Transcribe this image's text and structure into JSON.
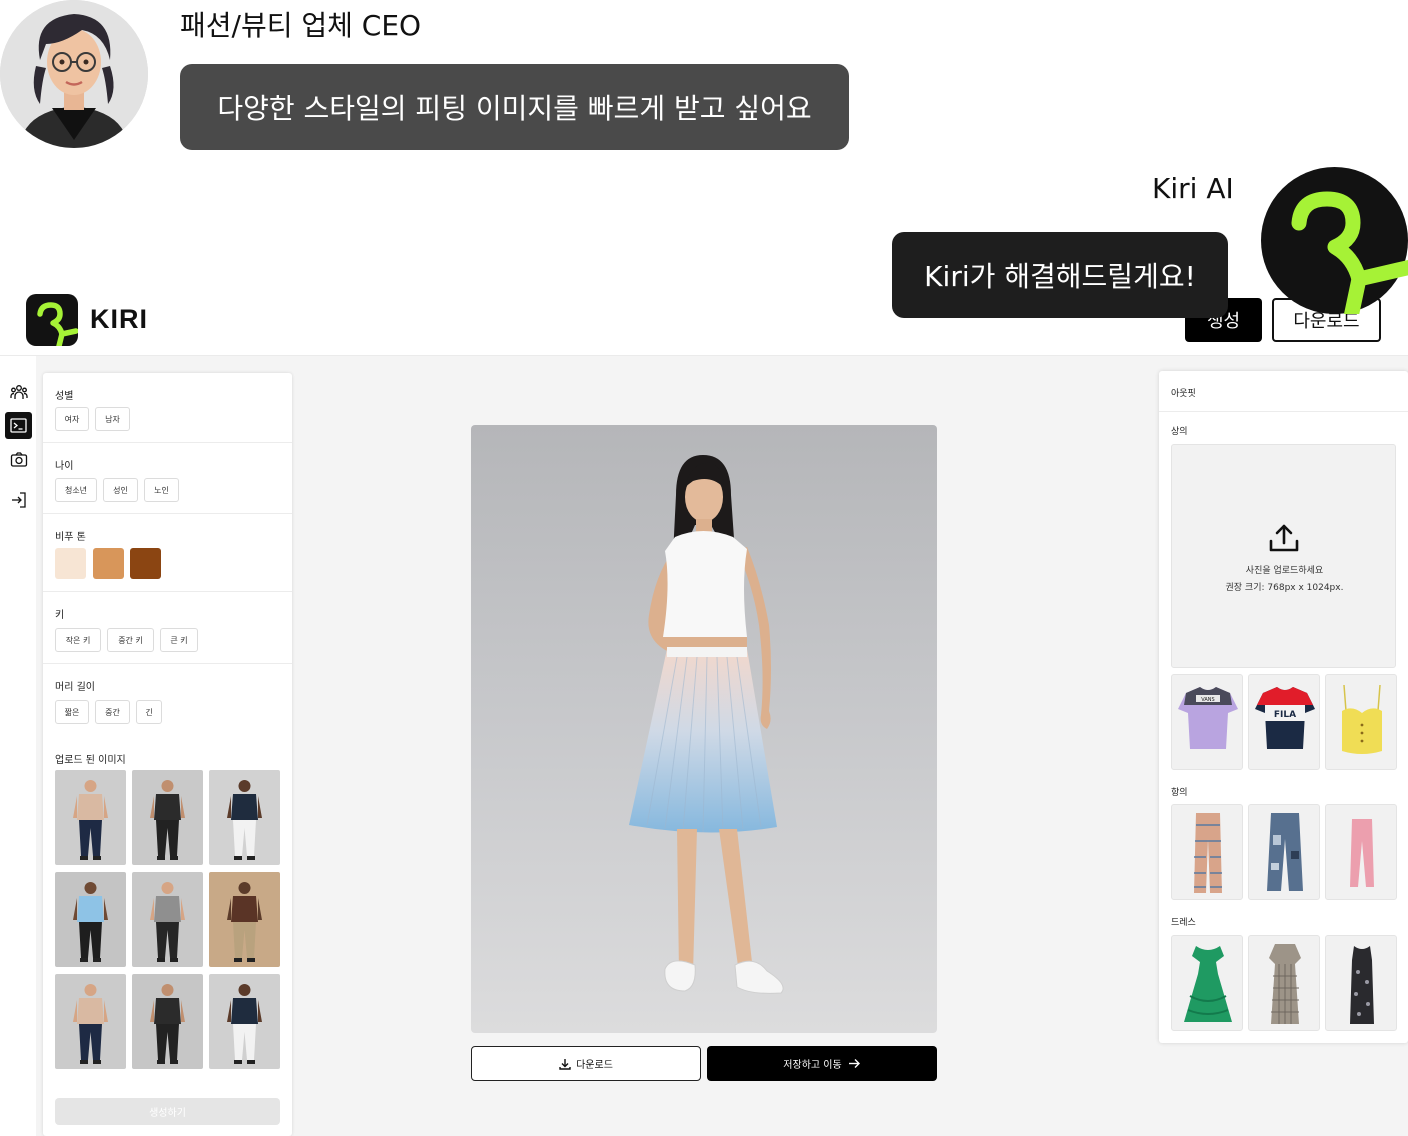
{
  "chat": {
    "ceo_name": "패션/뷰티 업체 CEO",
    "ceo_message": "다양한 스타일의 피팅 이미지를 빠르게 받고 싶어요",
    "ai_name": "Kiri AI",
    "ai_message": "Kiri가 해결해드릴게요!"
  },
  "header": {
    "logo_text": "KIRI",
    "generate_label": "생성",
    "download_label": "다운로드"
  },
  "rail": {
    "icons": [
      "users-icon",
      "terminal-icon",
      "camera-icon",
      "logout-icon"
    ],
    "active_index": 1
  },
  "left_panel": {
    "gender": {
      "title": "성별",
      "options": [
        "여자",
        "남자"
      ]
    },
    "age": {
      "title": "나이",
      "options": [
        "청소년",
        "성인",
        "노인"
      ]
    },
    "skin_tone": {
      "title": "비푸 톤",
      "colors": [
        "#f7e5d4",
        "#d8965a",
        "#8b4512"
      ]
    },
    "height": {
      "title": "키",
      "options": [
        "작은 키",
        "중간 키",
        "큰 키"
      ]
    },
    "hair_length": {
      "title": "머리 길이",
      "options": [
        "짧은",
        "중간",
        "긴"
      ]
    },
    "uploaded": {
      "title": "업로드 된 이미지"
    },
    "create_label": "생성하기"
  },
  "center": {
    "download_label": "다운로드",
    "save_label": "저장하고 이동"
  },
  "right_panel": {
    "title": "아웃핏",
    "top_label": "상의",
    "upload_line1": "사진을 업로드하세요",
    "upload_line2": "권장 크기: 768px x 1024px.",
    "bottom_label": "항의",
    "dress_label": "드레스",
    "tshirt_texts": [
      "VANS",
      "FILA"
    ]
  },
  "colors": {
    "accent": "#a6f236",
    "dark": "#121212"
  }
}
